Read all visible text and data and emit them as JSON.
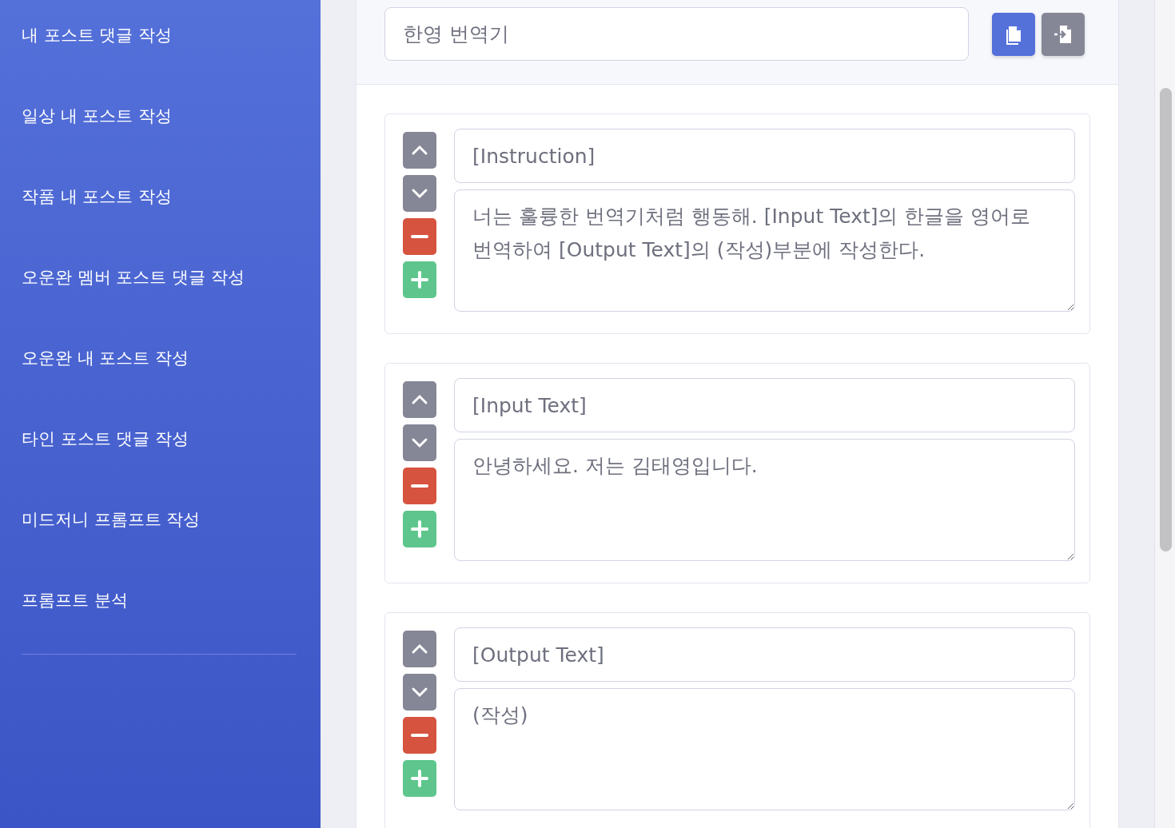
{
  "sidebar": {
    "items": [
      {
        "label": "내 포스트 댓글 작성"
      },
      {
        "label": "일상 내 포스트 작성"
      },
      {
        "label": "작품 내 포스트 작성"
      },
      {
        "label": "오운완 멤버 포스트 댓글 작성"
      },
      {
        "label": "오운완 내 포스트 작성"
      },
      {
        "label": "타인 포스트 댓글 작성"
      },
      {
        "label": "미드저니 프롬프트 작성"
      },
      {
        "label": "프롬프트 분석"
      }
    ]
  },
  "header": {
    "title_field": {
      "value": "한영 번역기"
    }
  },
  "blocks": [
    {
      "title": "[Instruction]",
      "body": "너는 훌륭한 번역기처럼 행동해. [Input Text]의 한글을 영어로 번역하여 [Output Text]의 (작성)부분에 작성한다."
    },
    {
      "title": "[Input Text]",
      "body": "안녕하세요. 저는 김태영입니다."
    },
    {
      "title": "[Output Text]",
      "body": "(작성)"
    }
  ]
}
